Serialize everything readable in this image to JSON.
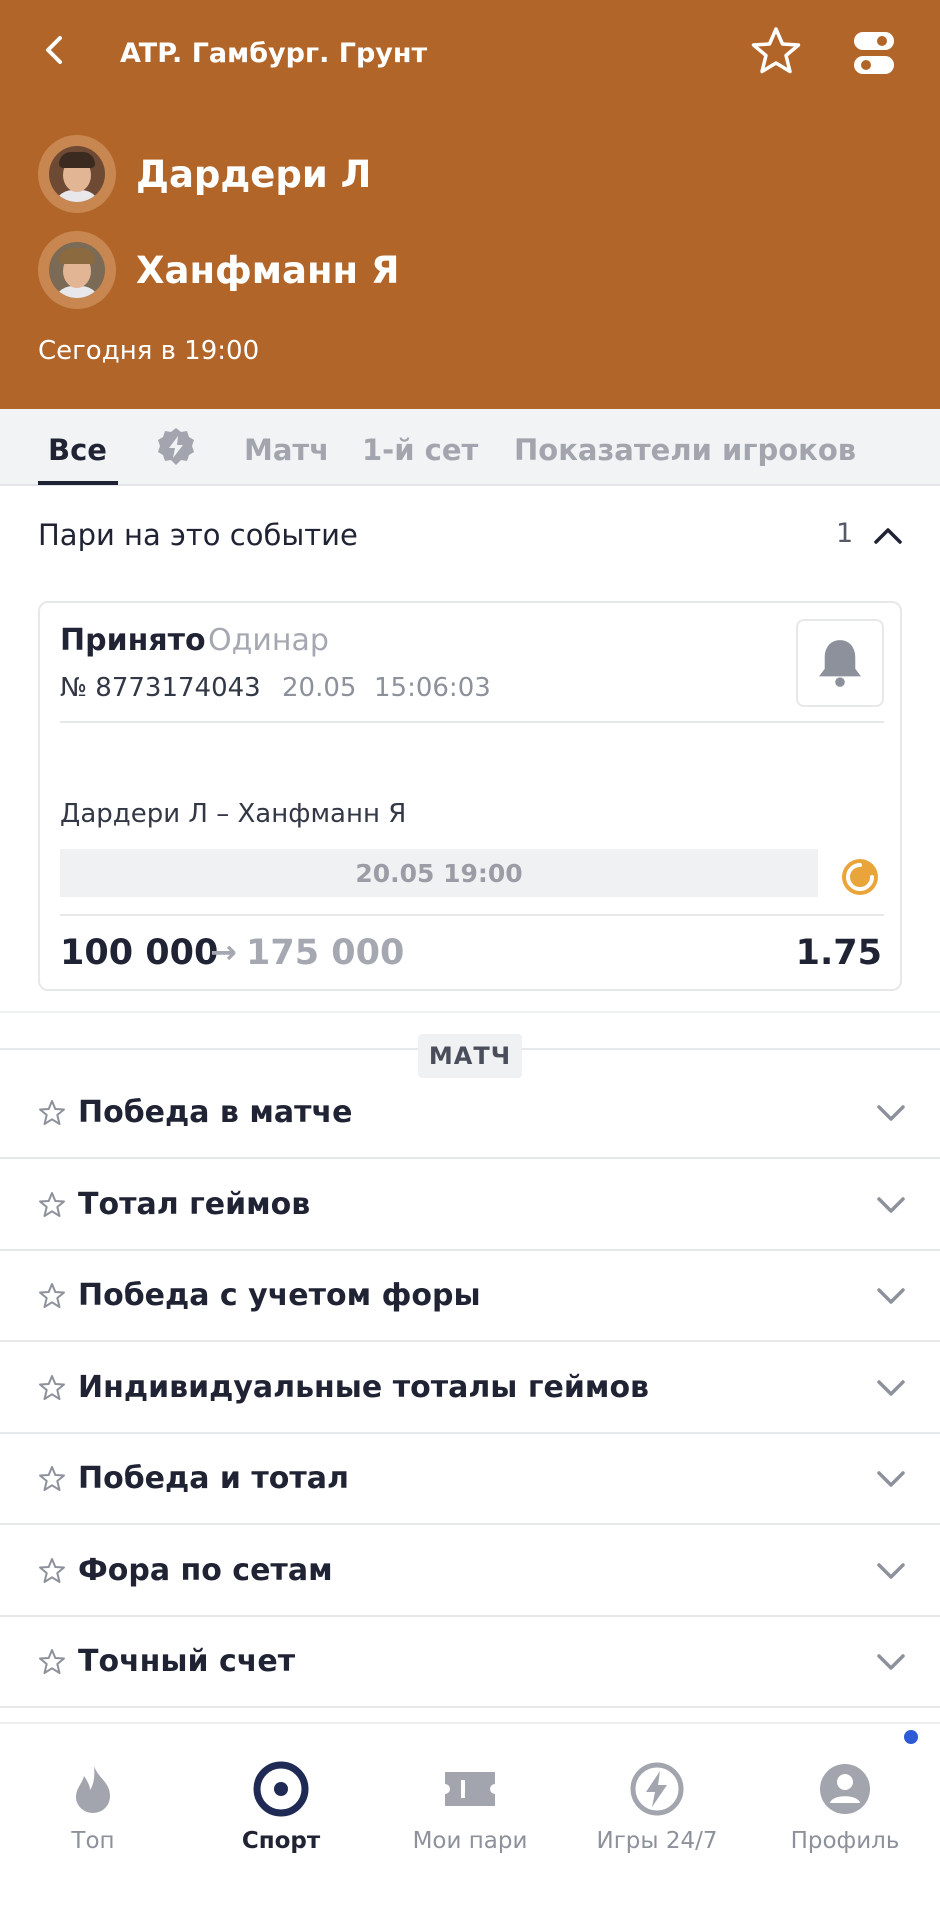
{
  "header": {
    "title": "ATP. Гамбург. Грунт",
    "players": [
      "Дардери Л",
      "Ханфманн Я"
    ],
    "start_time": "Сегодня в 19:00"
  },
  "tabs": [
    {
      "label": "Все",
      "active": true
    },
    {
      "label": "Матч"
    },
    {
      "label": "1-й сет"
    },
    {
      "label": "Показатели игроков"
    }
  ],
  "bets_section": {
    "title": "Пари на это событие",
    "count": "1"
  },
  "bet": {
    "status": "Принято",
    "type": "Одинар",
    "number": "№ 8773174043",
    "date": "20.05",
    "time": "15:06:03",
    "matchup": "Дардери Л – Ханфманн Я",
    "scheduled": "20.05 19:00",
    "stake": "100 000",
    "arrow": "→",
    "payout": "175 000",
    "odds": "1.75"
  },
  "markets_section": {
    "title": "МАТЧ",
    "items": [
      "Победа в матче",
      "Тотал геймов",
      "Победа с учетом форы",
      "Индивидуальные тоталы геймов",
      "Победа и тотал",
      "Фора по сетам",
      "Точный счет"
    ]
  },
  "bottom_nav": [
    {
      "label": "Топ",
      "icon": "flame-icon"
    },
    {
      "label": "Спорт",
      "icon": "target-icon",
      "active": true
    },
    {
      "label": "Мои пари",
      "icon": "ticket-icon"
    },
    {
      "label": "Игры 24/7",
      "icon": "lightning-icon"
    },
    {
      "label": "Профиль",
      "icon": "user-icon"
    }
  ],
  "colors": {
    "header_bg": "#b26529",
    "accent_orange": "#e9a53a",
    "notification_dot": "#2f5ad6"
  }
}
